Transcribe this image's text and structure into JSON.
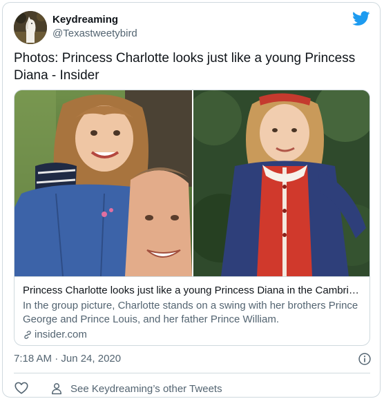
{
  "user": {
    "display_name": "Keydreaming",
    "handle": "@Texastweetybird",
    "avatar_icon": "white-horse-avatar"
  },
  "tweet": {
    "text": "Photos: Princess Charlotte looks just like a young Princess Diana - Insider",
    "timestamp": "7:18 AM · Jun 24, 2020"
  },
  "card": {
    "title": "Princess Charlotte looks just like a young Princess Diana in the Cambridge...",
    "description": "In the group picture, Charlotte stands on a swing with her brothers Prince George and Prince Louis, and her father Prince William.",
    "domain": "insider.com"
  },
  "actions": {
    "other_tweets_label": "See Keydreaming’s other Tweets"
  },
  "colors": {
    "brand_blue": "#1d9bf0",
    "text_primary": "#0f1419",
    "text_secondary": "#536471",
    "border": "#cfd9de"
  }
}
